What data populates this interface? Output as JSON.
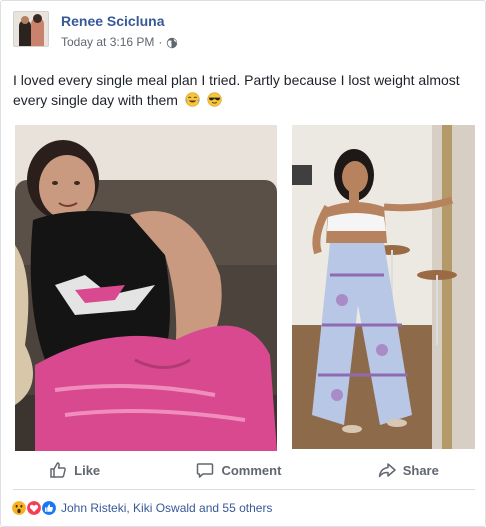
{
  "post": {
    "author": "Renee Scicluna",
    "timestamp": "Today at 3:16 PM",
    "separator": "·",
    "audience_icon": "globe-icon",
    "text": "I loved every single meal plan I tried. Partly because I lost weight almost every single day with them",
    "emojis": [
      "tears-of-joy-emoji",
      "sunglasses-emoji"
    ]
  },
  "photos": [
    {
      "name": "before-photo",
      "colors": {
        "shirt": "#141414",
        "shorts": "#d8498f",
        "sofa": "#5b5048"
      }
    },
    {
      "name": "after-photo",
      "colors": {
        "top": "#f5f5f5",
        "pants": "#b9c7e6",
        "wall": "#ece8e2"
      }
    }
  ],
  "actions": {
    "like": "Like",
    "comment": "Comment",
    "share": "Share"
  },
  "reactions": {
    "icons": [
      "wow-icon",
      "love-icon",
      "like-icon"
    ],
    "summary": "John Risteki, Kiki Oswald and 55 others"
  },
  "colors": {
    "link": "#385898",
    "secondary_text": "#606770",
    "like_blue": "#1877f2",
    "love_red": "#f33e58",
    "wow_yellow": "#f7b125"
  }
}
